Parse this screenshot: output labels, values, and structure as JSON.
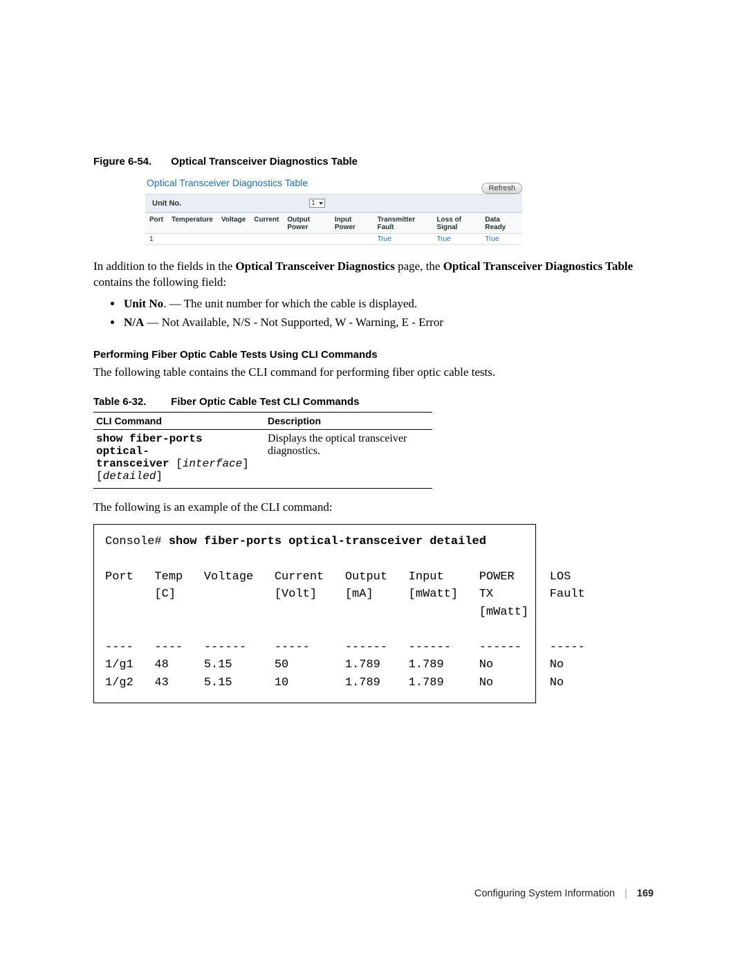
{
  "figure": {
    "label": "Figure 6-54.",
    "title": "Optical Transceiver Diagnostics Table"
  },
  "shot": {
    "title": "Optical Transceiver Diagnostics Table",
    "refresh": "Refresh",
    "unit_label": "Unit No.",
    "unit_value": "1",
    "headers": [
      "Port",
      "Temperature",
      "Voltage",
      "Current",
      "Output Power",
      "Input Power",
      "Transmitter Fault",
      "Loss of Signal",
      "Data Ready"
    ],
    "row": {
      "idx": "1",
      "transmitter_fault": "True",
      "loss_of_signal": "True",
      "data_ready": "True"
    }
  },
  "intro_para": {
    "pre": "In addition to the fields in the ",
    "b1": "Optical Transceiver Diagnostics",
    "mid": " page, the ",
    "b2": "Optical Transceiver Diagnostics Table",
    "post": " contains the following field:"
  },
  "bullets": {
    "b1_term": "Unit No",
    "b1_rest": ". — The unit number for which the cable is displayed.",
    "b2_term": "N/A",
    "b2_rest": " — Not Available, N/S - Not Supported, W - Warning, E - Error"
  },
  "sec_head": "Performing Fiber Optic Cable Tests Using CLI Commands",
  "sec_para": "The following table contains the CLI command for performing fiber optic cable tests.",
  "table_cap": {
    "label": "Table 6-32.",
    "title": "Fiber Optic Cable Test CLI Commands"
  },
  "cli_table": {
    "hdr1": "CLI Command",
    "hdr2": "Description",
    "cmd": {
      "l1a": "show fiber-ports optical-",
      "l2a": "transceiver",
      "l2b": " [",
      "l2c": "interface",
      "l2d": "]",
      "l3a": "[",
      "l3b": "detailed",
      "l3c": "]"
    },
    "desc": "Displays the optical transceiver diagnostics."
  },
  "example_para": "The following is an example of the CLI command:",
  "console": {
    "prompt": "Console# ",
    "command": "show fiber-ports optical-transceiver detailed",
    "header1": "Port   Temp   Voltage   Current   Output   Input     POWER     LOS",
    "header2": "       [C]              [Volt]    [mA]     [mWatt]   TX        Fault",
    "header3": "                                                     [mWatt]",
    "divider": "----   ----   ------    -----     ------   ------    ------    -----",
    "row1": "1/g1   48     5.15      50        1.789    1.789     No        No",
    "row2": "1/g2   43     5.15      10        1.789    1.789     No        No"
  },
  "footer": {
    "section": "Configuring System Information",
    "page": "169"
  }
}
